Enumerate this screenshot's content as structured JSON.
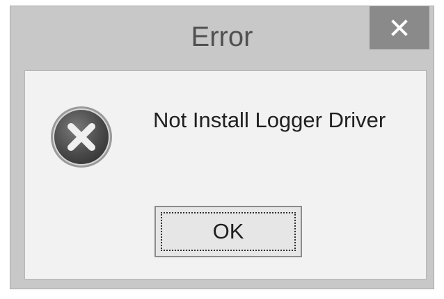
{
  "dialog": {
    "title": "Error",
    "message": "Not Install Logger Driver",
    "ok_label": "OK",
    "close_label": "×"
  },
  "icons": {
    "close": "close-icon",
    "error": "error-icon"
  },
  "colors": {
    "frame": "#c8c8c8",
    "close_button": "#8a8a8a",
    "content_background": "#f2f2f2",
    "button_background": "#e6e6e6",
    "icon_fill": "#4a4a4a"
  }
}
